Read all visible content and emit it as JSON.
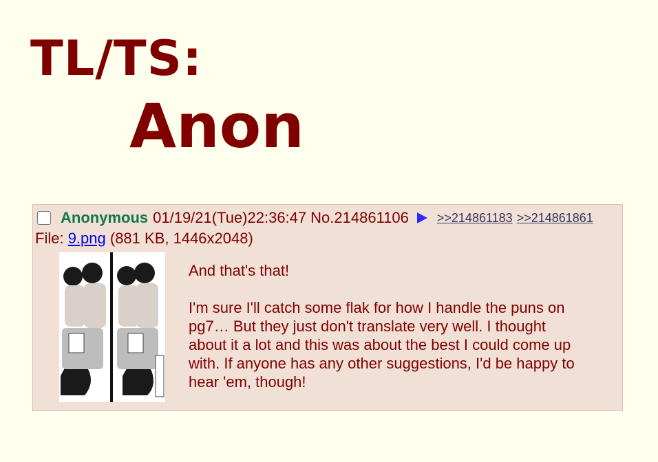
{
  "heading": {
    "line1": "TL/TS:",
    "line2": "Anon"
  },
  "post": {
    "name": "Anonymous",
    "datetime": "01/19/21(Tue)22:36:47",
    "number": "No.214861106",
    "backlinks": [
      ">>214861183",
      ">>214861861"
    ],
    "file": {
      "prefix": "File:",
      "filename": "9.png",
      "details": "(881 KB, 1446x2048)"
    },
    "message": [
      "And that's that!",
      "I'm sure I'll catch some flak for how I handle the puns on pg7… But they just don't translate very well. I thought about it a lot and this was about the best I could come up with. If anyone has any other suggestions, I'd be happy to hear 'em, though!"
    ]
  },
  "colors": {
    "background": "#ffffee",
    "post_background": "#f0e0d6",
    "text": "#800000",
    "name": "#117743",
    "link": "#0000ee",
    "backlink": "#34345c"
  }
}
